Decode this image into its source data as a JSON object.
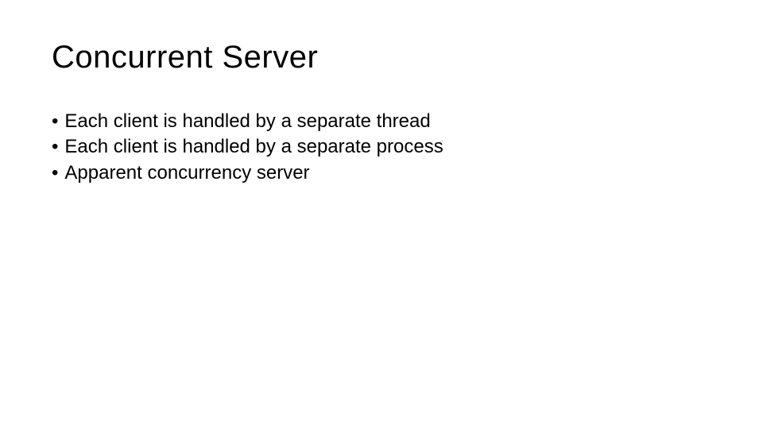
{
  "slide": {
    "title": "Concurrent Server",
    "bullets": [
      "Each client is handled by a separate thread",
      "Each client is handled by a separate process",
      "Apparent concurrency server"
    ]
  }
}
